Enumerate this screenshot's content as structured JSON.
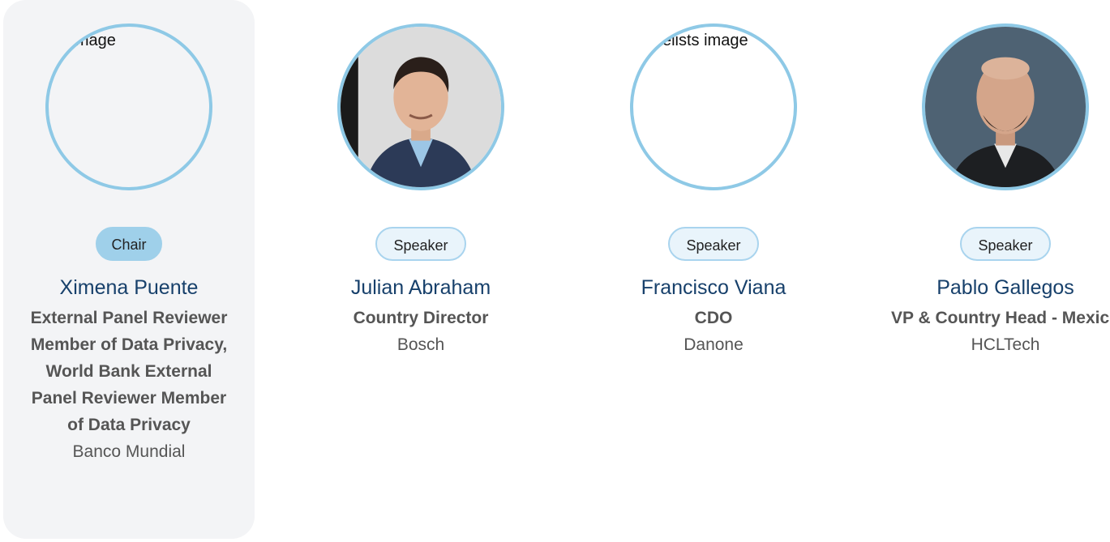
{
  "panel": {
    "members": [
      {
        "role": "Chair",
        "image_alt": "Chair image",
        "name": "Ximena Puente",
        "title": "External Panel Reviewer Member of Data Privacy, World Bank External Panel Reviewer Member of Data Privacy",
        "company": "Banco Mundial"
      },
      {
        "role": "Speaker",
        "name": "Julian Abraham",
        "title": "Country Director",
        "company": "Bosch"
      },
      {
        "role": "Speaker",
        "image_alt": "Panelists image",
        "name": "Francisco Viana",
        "title": "CDO",
        "company": "Danone"
      },
      {
        "role": "Speaker",
        "name": "Pablo Gallegos",
        "title": "VP & Country Head - Mexico",
        "company": "HCLTech"
      }
    ]
  },
  "colors": {
    "ring": "#8ec9e6",
    "chair_badge": "#9fd0ea",
    "speaker_badge": "#e9f4fb",
    "name": "#17406b",
    "card_bg": "#f3f4f6"
  }
}
